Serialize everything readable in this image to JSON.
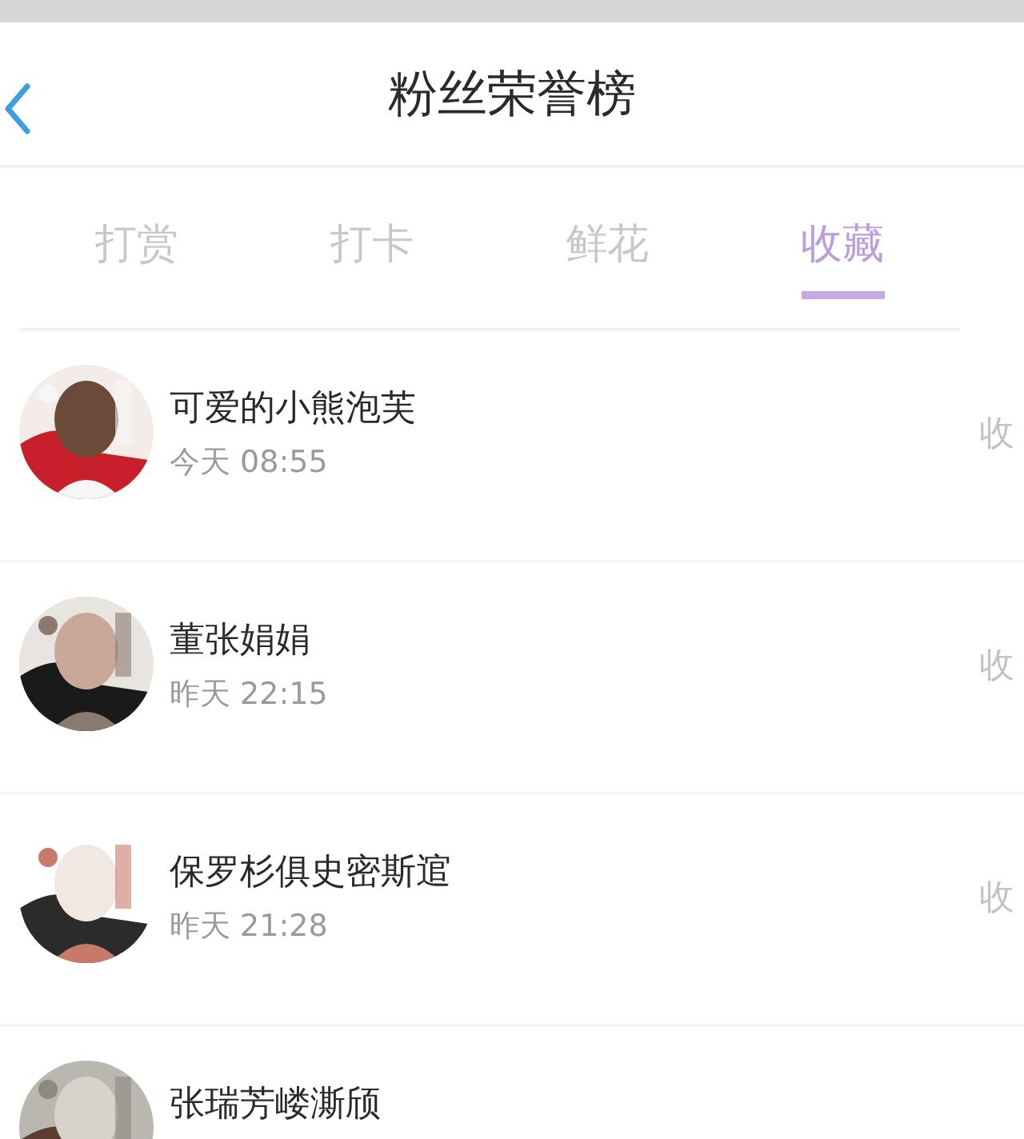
{
  "header": {
    "title": "粉丝荣誉榜"
  },
  "tabs": [
    {
      "label": "打赏",
      "selected": false
    },
    {
      "label": "打卡",
      "selected": false
    },
    {
      "label": "鲜花",
      "selected": false
    },
    {
      "label": "收藏",
      "selected": true
    }
  ],
  "rows": [
    {
      "name": "可爱的小熊泡芙",
      "time": "今天 08:55",
      "action": "收"
    },
    {
      "name": "董张娟娟",
      "time": "昨天 22:15",
      "action": "收"
    },
    {
      "name": "保罗杉俱史密斯逭",
      "time": "昨天 21:28",
      "action": "收"
    },
    {
      "name": "张瑞芳嵝澌颀"
    }
  ]
}
